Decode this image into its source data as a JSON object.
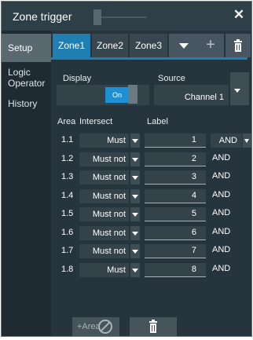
{
  "window": {
    "title": "Zone trigger"
  },
  "sidebar": {
    "items": [
      {
        "label": "Setup"
      },
      {
        "label": "Logic Operator"
      },
      {
        "label": "History"
      }
    ]
  },
  "tabs": {
    "items": [
      {
        "label": "Zone1"
      },
      {
        "label": "Zone2"
      },
      {
        "label": "Zone3"
      }
    ]
  },
  "display": {
    "label": "Display",
    "toggle_label": "On"
  },
  "source": {
    "label": "Source",
    "value": "Channel 1"
  },
  "table": {
    "headers": {
      "area": "Area",
      "intersect": "Intersect",
      "label": "Label"
    },
    "rows": [
      {
        "area": "1.1",
        "intersect": "Must",
        "label": "1",
        "operator": "AND"
      },
      {
        "area": "1.2",
        "intersect": "Must not",
        "label": "2",
        "operator": "AND"
      },
      {
        "area": "1.3",
        "intersect": "Must not",
        "label": "3",
        "operator": "AND"
      },
      {
        "area": "1.4",
        "intersect": "Must not",
        "label": "4",
        "operator": "AND"
      },
      {
        "area": "1.5",
        "intersect": "Must not",
        "label": "5",
        "operator": "AND"
      },
      {
        "area": "1.6",
        "intersect": "Must not",
        "label": "6",
        "operator": "AND"
      },
      {
        "area": "1.7",
        "intersect": "Must not",
        "label": "7",
        "operator": "AND"
      },
      {
        "area": "1.8",
        "intersect": "Must",
        "label": "8",
        "operator": "AND"
      }
    ]
  },
  "bottom": {
    "add_label": "+Area"
  },
  "colors": {
    "accent": "#1f7fb2",
    "toggle_on": "#1e8fd0",
    "panel": "#26353d"
  }
}
